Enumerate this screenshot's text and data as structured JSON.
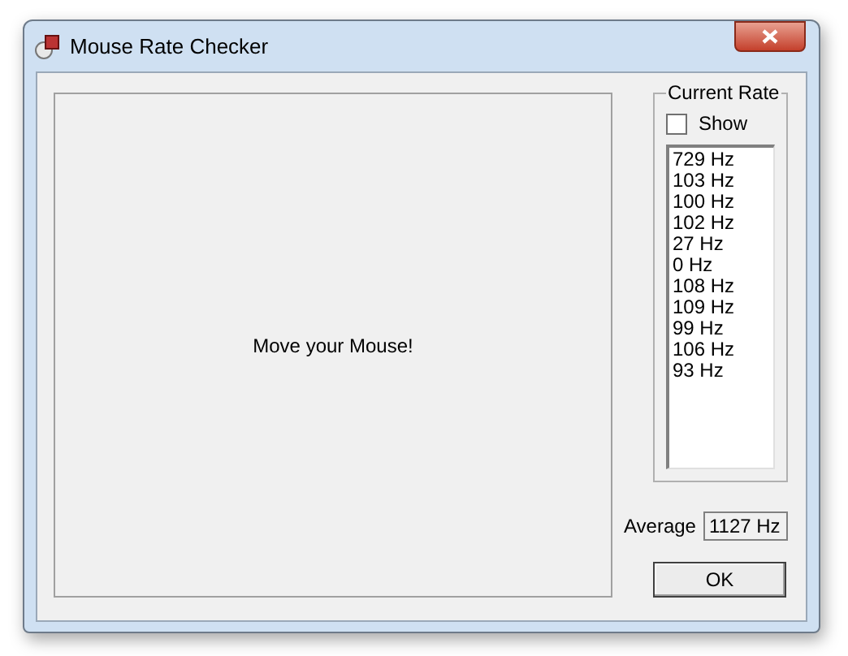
{
  "window": {
    "title": "Mouse Rate Checker"
  },
  "canvas": {
    "message": "Move your Mouse!"
  },
  "current_rate": {
    "title": "Current Rate",
    "show": {
      "label": "Show",
      "checked": false
    },
    "rates": [
      "729 Hz",
      "103 Hz",
      "100 Hz",
      "102 Hz",
      "27 Hz",
      "0 Hz",
      "108 Hz",
      "109 Hz",
      "99 Hz",
      "106 Hz",
      "93 Hz"
    ]
  },
  "average": {
    "label": "Average",
    "value": "1127 Hz"
  },
  "buttons": [
    "OK"
  ]
}
